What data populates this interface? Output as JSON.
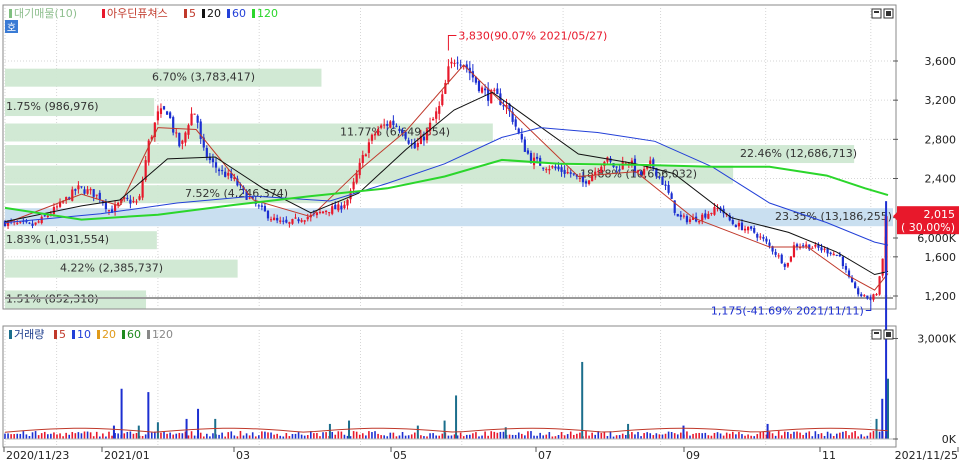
{
  "colors": {
    "up": "#e8182b",
    "down": "#1c2fd1",
    "ma5": "#c0392b",
    "ma20": "#111111",
    "ma60": "#2340d8",
    "ma120": "#2bd62b",
    "profile": "#cfe8d2",
    "profile_current": "#c9dff0",
    "grid": "#d6d6d6",
    "current_price_box": "#e8182b"
  },
  "legend": {
    "price_prefix": "대기매물(10)",
    "name": "아우딘퓨쳐스",
    "ma_items": [
      {
        "label": "5",
        "color": "#c0392b"
      },
      {
        "label": "20",
        "color": "#111111"
      },
      {
        "label": "60",
        "color": "#2340d8"
      },
      {
        "label": "120",
        "color": "#2bd62b"
      }
    ],
    "volume_title": "거래량",
    "volume_items": [
      {
        "label": "5",
        "color": "#c0392b"
      },
      {
        "label": "10",
        "color": "#2340d8"
      },
      {
        "label": "20",
        "color": "#e09a1a"
      },
      {
        "label": "60",
        "color": "#1e8a1e"
      },
      {
        "label": "120",
        "color": "#888888"
      }
    ],
    "corner_badge": "호"
  },
  "chart_data": [
    {
      "type": "candlestick",
      "title": "아우딘퓨쳐스",
      "x_range": [
        "2020/11/23",
        "2021/11/25"
      ],
      "x_tick_labels": [
        "2020/11/23",
        "2021/01",
        "03",
        "05",
        "07",
        "09",
        "11",
        "2021/11/25"
      ],
      "ylim": [
        1100,
        3900
      ],
      "y_ticks": [
        1200,
        1600,
        2000,
        2400,
        2800,
        3200,
        3600
      ],
      "y_tick_labels": [
        "1,200",
        "1,600",
        "2,000",
        "2,400",
        "2,800",
        "3,200",
        "3,600"
      ],
      "grid": true,
      "moving_averages": [
        "5",
        "20",
        "60",
        "120"
      ],
      "price_path": [
        [
          0,
          1950
        ],
        [
          8,
          1930
        ],
        [
          15,
          1920
        ],
        [
          22,
          2020
        ],
        [
          30,
          2150
        ],
        [
          38,
          2300
        ],
        [
          45,
          2260
        ],
        [
          50,
          2200
        ],
        [
          55,
          2060
        ],
        [
          62,
          2180
        ],
        [
          70,
          2150
        ],
        [
          75,
          2750
        ],
        [
          80,
          3050
        ],
        [
          85,
          3100
        ],
        [
          88,
          2900
        ],
        [
          92,
          2700
        ],
        [
          97,
          3050
        ],
        [
          100,
          3080
        ],
        [
          103,
          2700
        ],
        [
          108,
          2560
        ],
        [
          113,
          2470
        ],
        [
          120,
          2380
        ],
        [
          125,
          2250
        ],
        [
          130,
          2150
        ],
        [
          136,
          2050
        ],
        [
          142,
          1960
        ],
        [
          148,
          1930
        ],
        [
          155,
          2000
        ],
        [
          162,
          2020
        ],
        [
          168,
          2080
        ],
        [
          175,
          2100
        ],
        [
          180,
          2200
        ],
        [
          186,
          2550
        ],
        [
          190,
          2750
        ],
        [
          195,
          2900
        ],
        [
          202,
          2980
        ],
        [
          208,
          2900
        ],
        [
          214,
          2700
        ],
        [
          220,
          2850
        ],
        [
          228,
          3150
        ],
        [
          232,
          3500
        ],
        [
          236,
          3650
        ],
        [
          240,
          3580
        ],
        [
          246,
          3400
        ],
        [
          252,
          3250
        ],
        [
          256,
          3250
        ],
        [
          262,
          3150
        ],
        [
          266,
          3000
        ],
        [
          270,
          2780
        ],
        [
          275,
          2600
        ],
        [
          280,
          2550
        ],
        [
          288,
          2500
        ],
        [
          296,
          2450
        ],
        [
          302,
          2350
        ],
        [
          308,
          2460
        ],
        [
          314,
          2600
        ],
        [
          320,
          2500
        ],
        [
          326,
          2600
        ],
        [
          332,
          2420
        ],
        [
          338,
          2550
        ],
        [
          343,
          2400
        ],
        [
          347,
          2250
        ],
        [
          352,
          2000
        ],
        [
          358,
          1980
        ],
        [
          363,
          2000
        ],
        [
          368,
          2050
        ],
        [
          374,
          2100
        ],
        [
          380,
          1950
        ],
        [
          386,
          1900
        ],
        [
          392,
          1850
        ],
        [
          398,
          1750
        ],
        [
          404,
          1620
        ],
        [
          409,
          1500
        ],
        [
          413,
          1720
        ],
        [
          418,
          1720
        ],
        [
          425,
          1690
        ],
        [
          432,
          1650
        ],
        [
          437,
          1600
        ],
        [
          441,
          1400
        ],
        [
          445,
          1250
        ],
        [
          449,
          1190
        ],
        [
          453,
          1175
        ],
        [
          456,
          1230
        ],
        [
          459,
          1550
        ],
        [
          462,
          2015
        ]
      ],
      "price_series": [
        {
          "name": "5",
          "color": "#c0392b",
          "values": [
            [
              0,
              1940
            ],
            [
              40,
              2240
            ],
            [
              60,
              2120
            ],
            [
              80,
              2920
            ],
            [
              100,
              2900
            ],
            [
              130,
              2180
            ],
            [
              160,
              2010
            ],
            [
              185,
              2480
            ],
            [
              210,
              2890
            ],
            [
              240,
              3560
            ],
            [
              265,
              3080
            ],
            [
              300,
              2420
            ],
            [
              330,
              2470
            ],
            [
              360,
              2000
            ],
            [
              400,
              1700
            ],
            [
              420,
              1700
            ],
            [
              440,
              1420
            ],
            [
              455,
              1260
            ],
            [
              462,
              1430
            ]
          ]
        },
        {
          "name": "20",
          "color": "#111111",
          "values": [
            [
              0,
              1960
            ],
            [
              40,
              2120
            ],
            [
              60,
              2180
            ],
            [
              85,
              2600
            ],
            [
              110,
              2620
            ],
            [
              135,
              2300
            ],
            [
              160,
              2050
            ],
            [
              185,
              2250
            ],
            [
              210,
              2700
            ],
            [
              235,
              3100
            ],
            [
              255,
              3280
            ],
            [
              275,
              3000
            ],
            [
              300,
              2650
            ],
            [
              330,
              2550
            ],
            [
              350,
              2450
            ],
            [
              380,
              2000
            ],
            [
              410,
              1850
            ],
            [
              435,
              1650
            ],
            [
              455,
              1420
            ],
            [
              462,
              1450
            ]
          ]
        },
        {
          "name": "60",
          "color": "#2340d8",
          "values": [
            [
              0,
              1950
            ],
            [
              50,
              2040
            ],
            [
              90,
              2150
            ],
            [
              130,
              2220
            ],
            [
              170,
              2170
            ],
            [
              200,
              2350
            ],
            [
              230,
              2550
            ],
            [
              260,
              2820
            ],
            [
              280,
              2920
            ],
            [
              310,
              2870
            ],
            [
              340,
              2780
            ],
            [
              370,
              2520
            ],
            [
              400,
              2150
            ],
            [
              430,
              1950
            ],
            [
              455,
              1750
            ],
            [
              462,
              1720
            ]
          ]
        },
        {
          "name": "120",
          "color": "#2bd62b",
          "values": [
            [
              0,
              2100
            ],
            [
              40,
              1980
            ],
            [
              80,
              2030
            ],
            [
              120,
              2130
            ],
            [
              160,
              2220
            ],
            [
              200,
              2300
            ],
            [
              230,
              2420
            ],
            [
              260,
              2590
            ],
            [
              290,
              2550
            ],
            [
              330,
              2540
            ],
            [
              370,
              2520
            ],
            [
              400,
              2520
            ],
            [
              430,
              2430
            ],
            [
              450,
              2300
            ],
            [
              462,
              2230
            ]
          ]
        }
      ],
      "volume_profile": [
        {
          "price": 1175,
          "label": "1.51% (852,318)",
          "share": 1.51
        },
        {
          "price": 1490,
          "label": "4.22% (2,385,737)",
          "share": 4.22
        },
        {
          "price": 1780,
          "label": "1.83% (1,031,554)",
          "share": 1.83
        },
        {
          "price": 2015,
          "label": "23.35% (13,186,255)",
          "share": 23.35,
          "current": true
        },
        {
          "price": 2250,
          "label": "7.52% (4,246,374)",
          "share": 7.52
        },
        {
          "price": 2450,
          "label": "18.88% (10,666,032)",
          "share": 18.88
        },
        {
          "price": 2660,
          "label": "22.46% (12,686,713)",
          "share": 22.46
        },
        {
          "price": 2880,
          "label": "11.77% (6,649,354)",
          "share": 11.77
        },
        {
          "price": 3140,
          "label": "1.75% (986,976)",
          "share": 1.75
        },
        {
          "price": 3440,
          "label": "6.70% (3,783,417)",
          "share": 6.7
        }
      ],
      "annotations": [
        {
          "label": "3,830(90.07% 2021/05/27)",
          "x": 232,
          "y": 3830
        },
        {
          "label": "1,175(-41.69% 2021/11/11)",
          "x": 453,
          "y": 1175
        }
      ],
      "current_price": {
        "value": "2,015",
        "change": "( 30.00%)"
      }
    },
    {
      "type": "bar",
      "title": "거래량",
      "ylim": [
        0,
        8500000
      ],
      "y_ticks": [
        0,
        3000000,
        6000000
      ],
      "y_tick_labels": [
        "0K",
        "3,000K",
        "6,000K"
      ],
      "x_range": [
        "2020/11/23",
        "2021/11/25"
      ],
      "moving_averages": [
        "5",
        "10",
        "20",
        "60",
        "120"
      ],
      "spikes": [
        {
          "x": 57,
          "value": 400000
        },
        {
          "x": 61,
          "value": 1500000
        },
        {
          "x": 70,
          "value": 400000
        },
        {
          "x": 75,
          "value": 1400000
        },
        {
          "x": 80,
          "value": 500000
        },
        {
          "x": 95,
          "value": 600000
        },
        {
          "x": 101,
          "value": 900000
        },
        {
          "x": 110,
          "value": 600000
        },
        {
          "x": 170,
          "value": 450000
        },
        {
          "x": 180,
          "value": 550000
        },
        {
          "x": 216,
          "value": 400000
        },
        {
          "x": 230,
          "value": 550000
        },
        {
          "x": 236,
          "value": 1300000
        },
        {
          "x": 262,
          "value": 350000
        },
        {
          "x": 302,
          "value": 2300000
        },
        {
          "x": 326,
          "value": 450000
        },
        {
          "x": 355,
          "value": 400000
        },
        {
          "x": 399,
          "value": 450000
        },
        {
          "x": 456,
          "value": 600000
        },
        {
          "x": 459,
          "value": 1200000
        },
        {
          "x": 461,
          "value": 7100000
        },
        {
          "x": 462,
          "value": 1800000
        }
      ],
      "baseline_volume": 120000
    }
  ]
}
